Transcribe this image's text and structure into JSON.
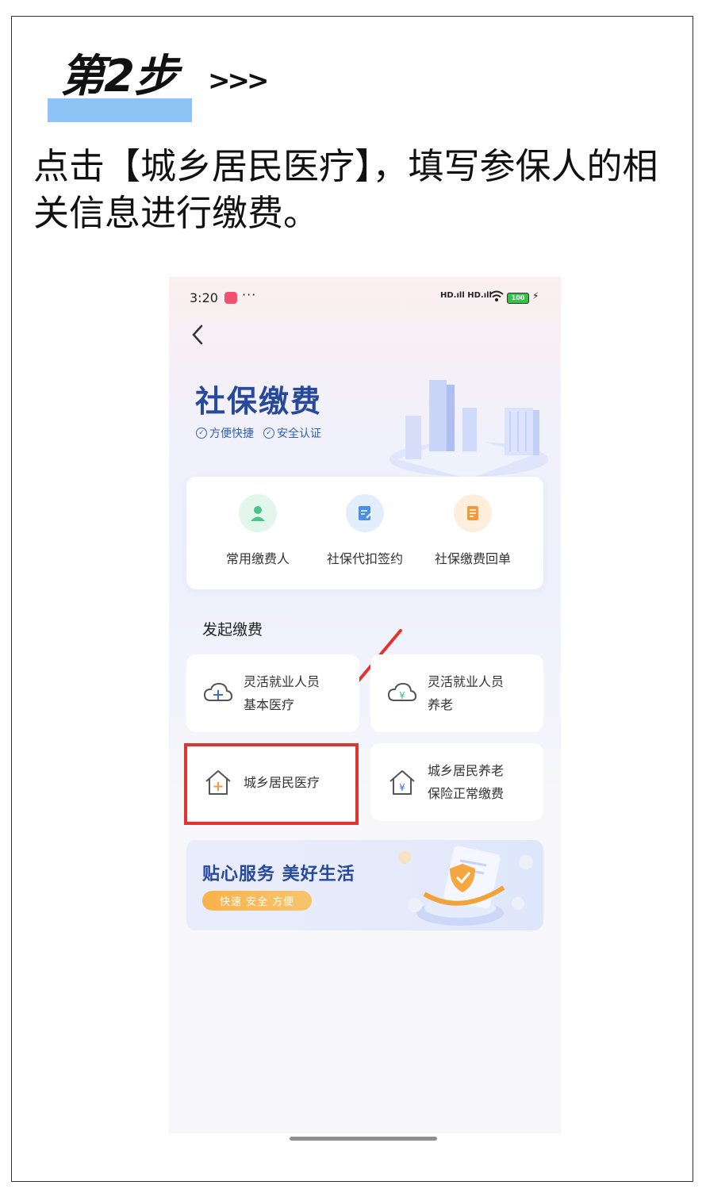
{
  "step": {
    "title": "第2步",
    "arrows": ">>>"
  },
  "instruction": "点击【城乡居民医疗】，填写参保人的相关信息进行缴费。",
  "status_bar": {
    "time": "3:20",
    "dots": "···",
    "signal": "HD.ıll HD.ıll",
    "battery": "100"
  },
  "hero": {
    "title": "社保缴费",
    "tags": [
      "方便快捷",
      "安全认证"
    ]
  },
  "quick_actions": [
    {
      "label": "常用缴费人",
      "icon": "person-icon",
      "color": "#4cc38a",
      "bg": "#e3f6ec"
    },
    {
      "label": "社保代扣签约",
      "icon": "document-edit-icon",
      "color": "#4a90e2",
      "bg": "#e3eefc"
    },
    {
      "label": "社保缴费回单",
      "icon": "receipt-icon",
      "color": "#f39a3a",
      "bg": "#fdeedd"
    }
  ],
  "section_title": "发起缴费",
  "payment_options": [
    {
      "line1": "灵活就业人员",
      "line2": "基本医疗",
      "icon": "cloud-plus-icon"
    },
    {
      "line1": "灵活就业人员",
      "line2": "养老",
      "icon": "cloud-yen-icon"
    },
    {
      "line1": "城乡居民医疗",
      "line2": "",
      "icon": "house-plus-icon"
    },
    {
      "line1": "城乡居民养老",
      "line2": "保险正常缴费",
      "icon": "house-yen-icon"
    }
  ],
  "banner": {
    "title": "贴心服务 美好生活",
    "subtitle": "快速 安全 方便"
  },
  "colors": {
    "accent": "#27499b",
    "highlight": "#e0342f",
    "step_bar": "#8ec3f6"
  }
}
